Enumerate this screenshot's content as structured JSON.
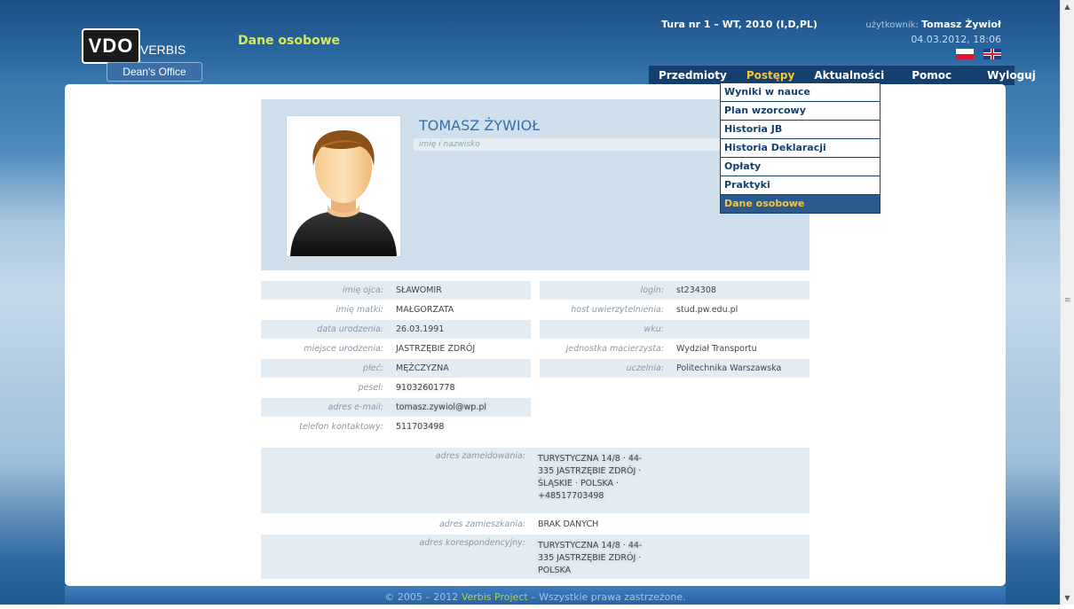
{
  "header": {
    "logo": {
      "vdo": "VDO",
      "verbis": "VERBIS",
      "deans": "Dean's Office"
    },
    "page_title": "Dane osobowe",
    "tura": "Tura nr 1 – WT, 2010 (I,D,PL)",
    "user_label": "użytkownik:",
    "user_name": "Tomasz Żywioł",
    "datetime": "04.03.2012, 18:06"
  },
  "nav": {
    "items": [
      {
        "label": "Przedmioty"
      },
      {
        "label": "Postępy"
      },
      {
        "label": "Aktualności"
      },
      {
        "label": "Pomoc"
      },
      {
        "label": "Wyloguj"
      }
    ],
    "active": "Postępy"
  },
  "dropdown": {
    "items": [
      {
        "label": "Wyniki w nauce"
      },
      {
        "label": "Plan wzorcowy"
      },
      {
        "label": "Historia JB"
      },
      {
        "label": "Historia Deklaracji"
      },
      {
        "label": "Opłaty"
      },
      {
        "label": "Praktyki"
      },
      {
        "label": "Dane osobowe"
      }
    ],
    "selected": "Dane osobowe"
  },
  "profile": {
    "full_name": "TOMASZ ŻYWIOŁ",
    "name_label": "imię i nazwisko",
    "left": [
      {
        "label": "imię ojca:",
        "value": "SŁAWOMIR"
      },
      {
        "label": "imię matki:",
        "value": "MAŁGORZATA"
      },
      {
        "label": "data urodzenia:",
        "value": "26.03.1991"
      },
      {
        "label": "miejsce urodzenia:",
        "value": "JASTRZĘBIE ZDRÓJ"
      },
      {
        "label": "płeć:",
        "value": "MĘŻCZYZNA"
      },
      {
        "label": "pesel:",
        "value": "91032601778"
      },
      {
        "label": "adres e-mail:",
        "value": "tomasz.zywiol@wp.pl"
      },
      {
        "label": "telefon kontaktowy:",
        "value": "511703498"
      }
    ],
    "right": [
      {
        "label": "login:",
        "value": "st234308"
      },
      {
        "label": "host uwierzytelnienia:",
        "value": "stud.pw.edu.pl"
      },
      {
        "label": "wku:",
        "value": ""
      },
      {
        "label": "jednostka macierzysta:",
        "value": "Wydział Transportu"
      },
      {
        "label": "uczelnia:",
        "value": "Politechnika Warszawska"
      }
    ],
    "addresses": [
      {
        "label": "adres zameldowania:",
        "value": "TURYSTYCZNA 14/8 · 44-335 JASTRZĘBIE ZDRÓJ · ŚLĄSKIE · POLSKA · +48517703498"
      },
      {
        "label": "adres zamieszkania:",
        "value": "BRAK DANYCH"
      },
      {
        "label": "adres korespondencyjny:",
        "value": "TURYSTYCZNA 14/8 · 44-335 JASTRZĘBIE ZDRÓJ · POLSKA"
      }
    ]
  },
  "footer": {
    "pre": "© 2005 – 2012 ",
    "brand": "Verbis Project",
    "post": " – Wszystkie prawa zastrzeżone."
  },
  "colors": {
    "nav_bg": "#13406f",
    "active": "#f5c53a",
    "accent": "#3a70a6",
    "title": "#d6e85a"
  }
}
